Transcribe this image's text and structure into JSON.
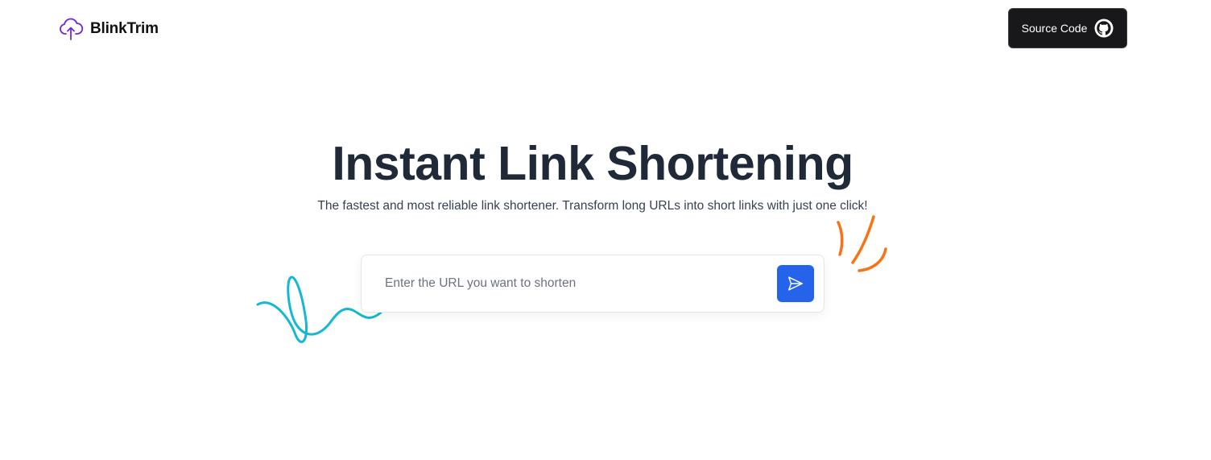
{
  "header": {
    "brand_name": "BlinkTrim",
    "brand_icon": "cloud-upload-icon",
    "source_button_label": "Source Code",
    "source_button_icon": "github-icon"
  },
  "hero": {
    "title": "Instant Link Shortening",
    "subtitle": "The fastest and most reliable link shortener. Transform long URLs into short links with just one click!"
  },
  "url_form": {
    "value": "",
    "placeholder": "Enter the URL you want to shorten",
    "submit_icon": "send-icon"
  },
  "colors": {
    "brand_accent": "#7c3aed",
    "primary_button": "#2563eb",
    "dark_button": "#18181b",
    "squiggle_cyan": "#14b8d4",
    "squiggle_orange": "#f97316"
  }
}
